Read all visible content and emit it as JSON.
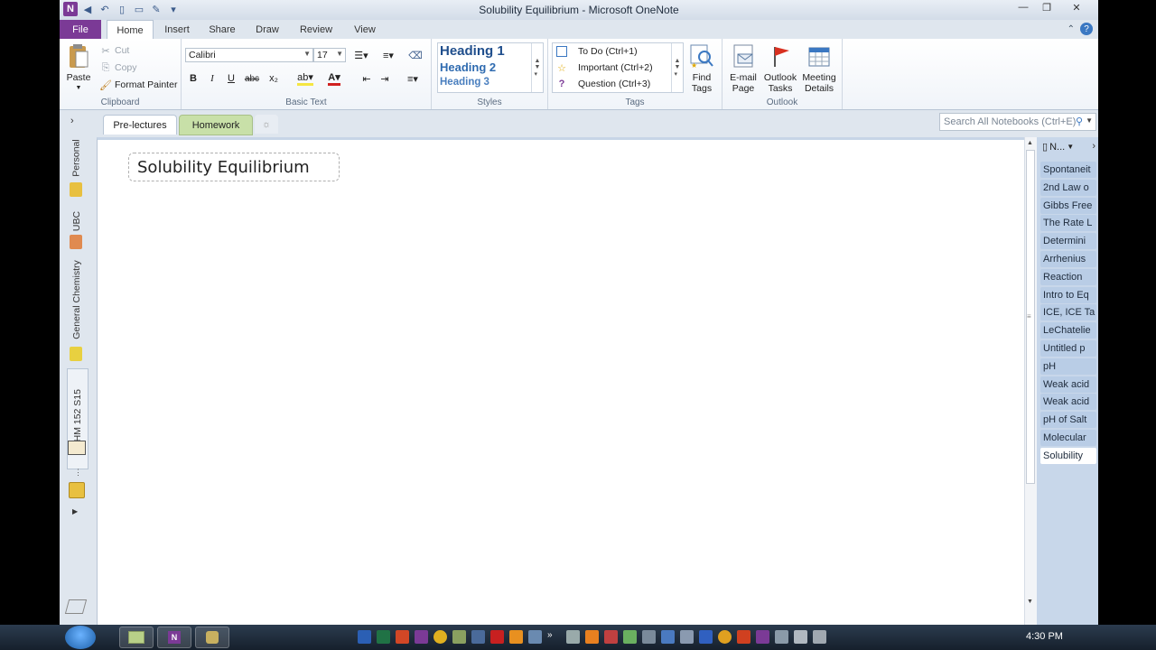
{
  "window": {
    "title": "Solubility Equilibrium - Microsoft OneNote",
    "app_icon_letter": "N"
  },
  "ribbon_tabs": {
    "file": "File",
    "home": "Home",
    "insert": "Insert",
    "share": "Share",
    "draw": "Draw",
    "review": "Review",
    "view": "View"
  },
  "clipboard": {
    "paste": "Paste",
    "cut": "Cut",
    "copy": "Copy",
    "format_painter": "Format Painter",
    "label": "Clipboard"
  },
  "basic_text": {
    "font": "Calibri",
    "size": "17",
    "label": "Basic Text",
    "bold": "B",
    "italic": "I",
    "underline": "U",
    "strike": "abc",
    "subscript": "x₂"
  },
  "styles": {
    "h1": "Heading 1",
    "h2": "Heading 2",
    "h3": "Heading 3",
    "label": "Styles"
  },
  "tags": {
    "todo": "To Do (Ctrl+1)",
    "important": "Important (Ctrl+2)",
    "question": "Question (Ctrl+3)",
    "label": "Tags",
    "find_tags_1": "Find",
    "find_tags_2": "Tags"
  },
  "outlook": {
    "email_1": "E-mail",
    "email_2": "Page",
    "tasks_1": "Outlook",
    "tasks_2": "Tasks",
    "meeting_1": "Meeting",
    "meeting_2": "Details",
    "label": "Outlook"
  },
  "notebooks": [
    {
      "name": "Personal",
      "color": "#e8c040"
    },
    {
      "name": "UBC",
      "color": "#e08a50"
    },
    {
      "name": "General Chemistry",
      "color": "#e8d040"
    },
    {
      "name": "CHM 152 S15",
      "color": "#e8d8a0"
    }
  ],
  "sections": {
    "tab1": "Pre-lectures",
    "tab2": "Homework"
  },
  "search": {
    "placeholder": "Search All Notebooks (Ctrl+E)"
  },
  "page": {
    "title": "Solubility Equilibrium"
  },
  "pages_header": "N...",
  "pages": [
    "Spontaneit",
    "2nd Law o",
    "Gibbs Free",
    "The Rate L",
    "Determini",
    "Arrhenius",
    "Reaction",
    "Intro to Eq",
    "ICE, ICE Ta",
    "LeChatelie",
    "Untitled p",
    "pH",
    "Weak acid",
    "Weak acid",
    "pH of Salt",
    "Molecular",
    "Solubility"
  ],
  "taskbar": {
    "clock": "4:30 PM"
  },
  "colors": {
    "file_tab": "#7b3a96",
    "page_list_bg": "#c8d7ea",
    "accent_blue": "#1f4e8c"
  }
}
